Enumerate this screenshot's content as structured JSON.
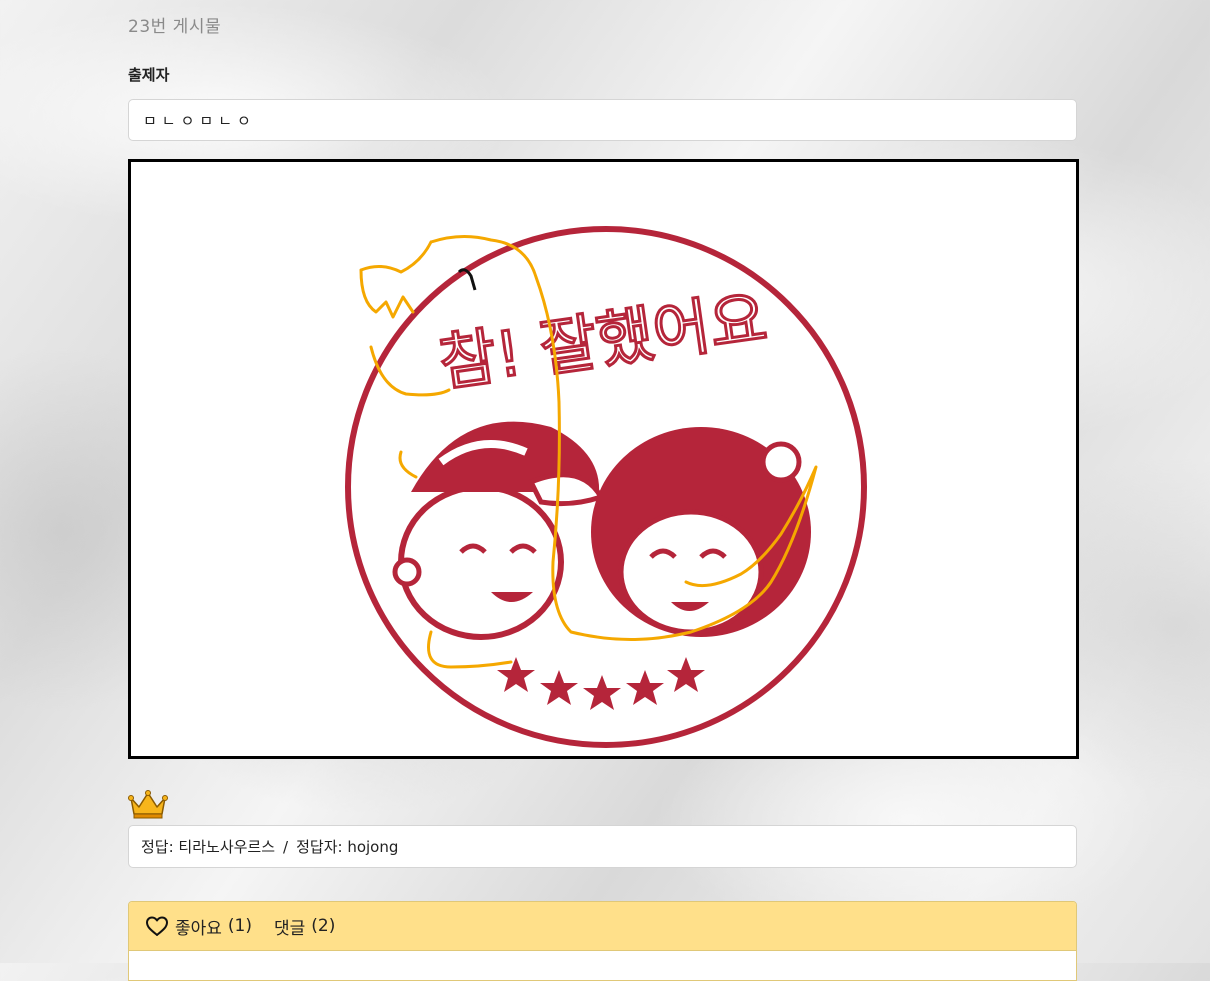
{
  "post": {
    "title": "23번 게시물",
    "author_label": "출제자",
    "author_value": "ㅁㄴㅇㅁㄴㅇ"
  },
  "drawing": {
    "stamp_text": "참! 잘했어요",
    "stamp_color": "#b5253a",
    "scribble_color": "#f5a800"
  },
  "answer": {
    "answer_text": "정답: 티라노사우르스",
    "separator": "/",
    "solver_text": "정답자: hojong"
  },
  "actions": {
    "like_label": "좋아요",
    "like_count": "(1)",
    "comment_label": "댓글",
    "comment_count": "(2)"
  },
  "icons": {
    "crown": "crown-icon",
    "like": "heart-outline-icon"
  },
  "colors": {
    "header_bar": "#ffe08a",
    "crown_gold": "#f7b51b"
  }
}
